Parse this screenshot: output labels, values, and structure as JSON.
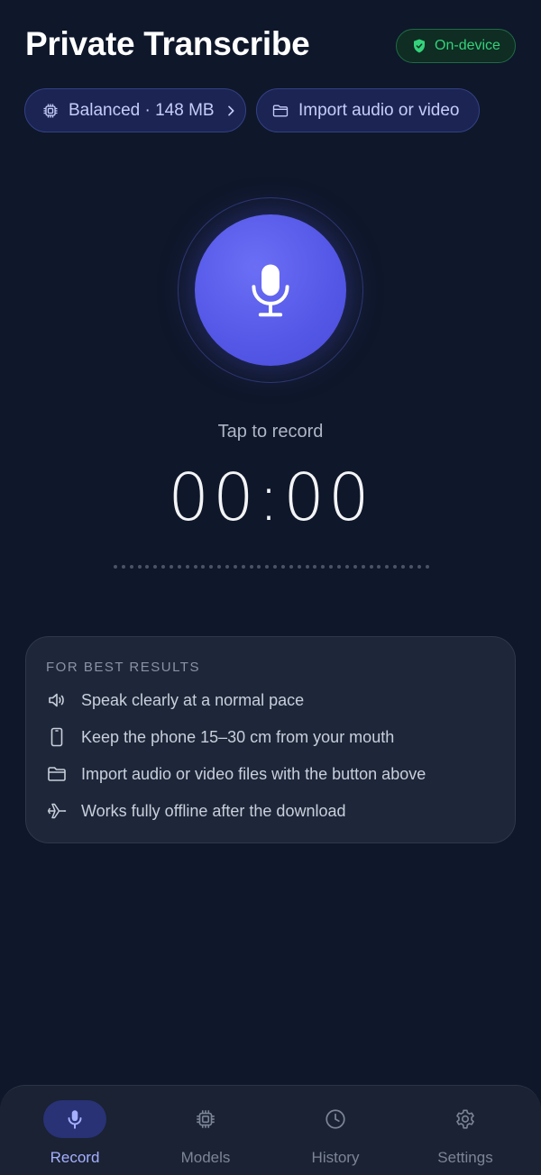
{
  "header": {
    "title": "Private Transcribe",
    "badge_label": "On-device"
  },
  "chips": {
    "model_label": "Balanced · 148 MB",
    "import_label": "Import audio or video"
  },
  "recorder": {
    "tap_label": "Tap to record",
    "timer": "00:00"
  },
  "tips": {
    "heading": "FOR BEST RESULTS",
    "items": [
      {
        "icon": "speaker-icon",
        "text": "Speak clearly at a normal pace"
      },
      {
        "icon": "phone-icon",
        "text": "Keep the phone 15–30 cm from your mouth"
      },
      {
        "icon": "folder-icon",
        "text": "Import audio or video files with the button above"
      },
      {
        "icon": "airplane-icon",
        "text": "Works fully offline after the download"
      }
    ]
  },
  "nav": {
    "items": [
      {
        "label": "Record",
        "icon": "mic-icon",
        "active": true
      },
      {
        "label": "Models",
        "icon": "chip-icon",
        "active": false
      },
      {
        "label": "History",
        "icon": "clock-icon",
        "active": false
      },
      {
        "label": "Settings",
        "icon": "gear-icon",
        "active": false
      }
    ]
  },
  "colors": {
    "background": "#0f172a",
    "accent": "#5457e6",
    "badge_green": "#34d27b",
    "nav_active": "#a5b0ff"
  }
}
